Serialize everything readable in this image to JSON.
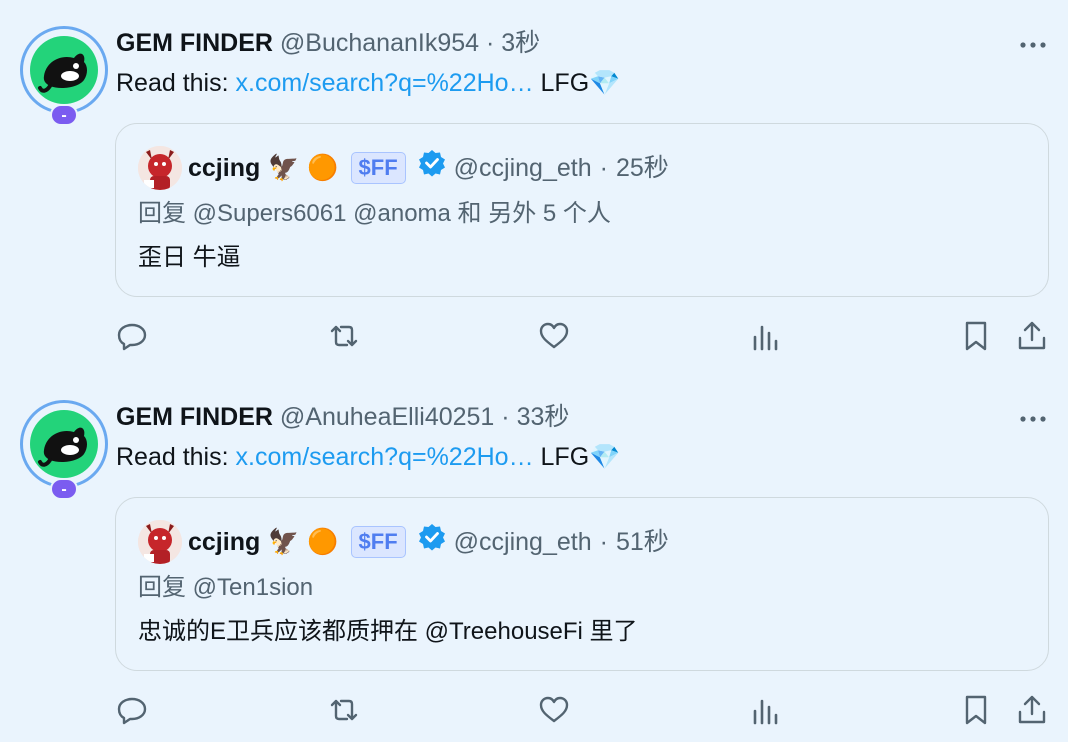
{
  "colors": {
    "background": "#eaf4fd",
    "link": "#1d9bf0",
    "muted": "#536471",
    "avatar_green": "#23d37a",
    "badge_purple": "#7b5cf0",
    "verified_blue": "#1d9bf0"
  },
  "tweets": [
    {
      "name": "GEM FINDER",
      "handle": "@BuchananIk954",
      "dot": "·",
      "time": "3秒",
      "badge": "-",
      "text_prefix": "Read this: ",
      "link": "x.com/search?q=%22Ho…",
      "text_suffix": " LFG",
      "text_emoji": "💎",
      "quote": {
        "name": "ccjing",
        "emoji_eagle": "🦅",
        "emoji_orange": "🟠",
        "tag": "$FF",
        "handle": "@ccjing_eth",
        "dot": "·",
        "time": "25秒",
        "reply": "回复 @Supers6061 @anoma 和 另外 5 个人",
        "text": "歪日 牛逼"
      }
    },
    {
      "name": "GEM FINDER",
      "handle": "@AnuheaElli40251",
      "dot": "·",
      "time": "33秒",
      "badge": "-",
      "text_prefix": "Read this: ",
      "link": "x.com/search?q=%22Ho…",
      "text_suffix": " LFG",
      "text_emoji": "💎",
      "quote": {
        "name": "ccjing",
        "emoji_eagle": "🦅",
        "emoji_orange": "🟠",
        "tag": "$FF",
        "handle": "@ccjing_eth",
        "dot": "·",
        "time": "51秒",
        "reply": "回复 @Ten1sion",
        "text": "忠诚的E卫兵应该都质押在 @TreehouseFi 里了"
      }
    }
  ],
  "icons": {
    "more": "more-horizontal-icon",
    "reply": "reply-icon",
    "retweet": "retweet-icon",
    "like": "heart-icon",
    "views": "views-chart-icon",
    "bookmark": "bookmark-icon",
    "share": "share-icon"
  }
}
